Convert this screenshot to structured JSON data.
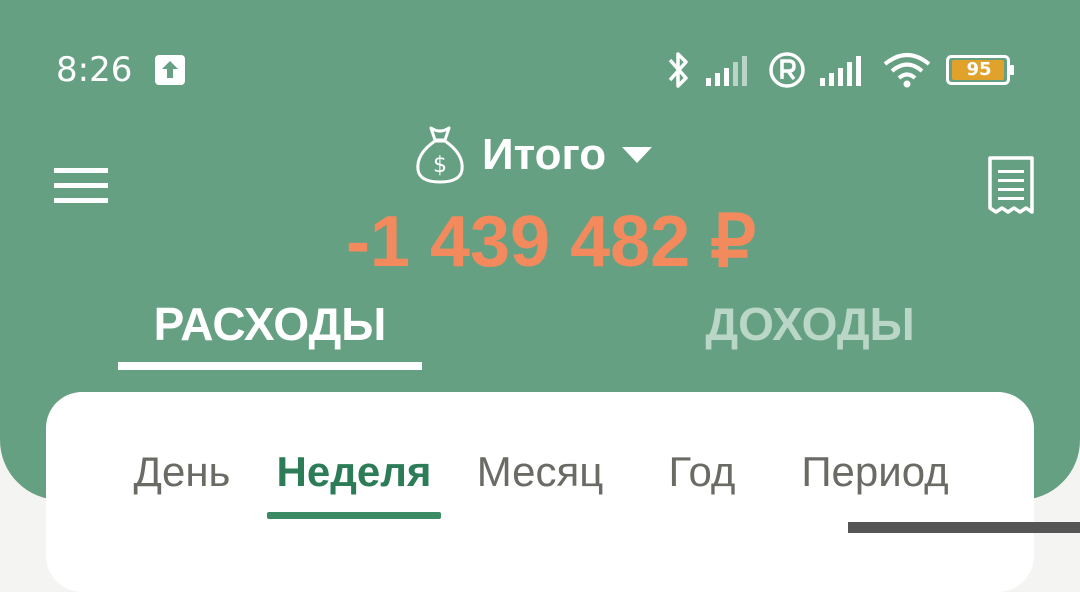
{
  "status_bar": {
    "time": "8:26",
    "battery_level": "95",
    "icons": [
      "upload-icon",
      "bluetooth-icon",
      "signal-icon",
      "roaming-icon",
      "signal-icon",
      "wifi-icon",
      "battery-icon"
    ]
  },
  "header": {
    "account_icon": "money-bag-icon",
    "account_title": "Итого",
    "total_amount": "-1 439 482 ₽"
  },
  "type_tabs": {
    "expenses": "РАСХОДЫ",
    "income": "ДОХОДЫ",
    "selected": "expenses"
  },
  "period_tabs": {
    "day": "День",
    "week": "Неделя",
    "month": "Месяц",
    "year": "Год",
    "period": "Период",
    "selected": "week"
  },
  "colors": {
    "header_background": "#66a083",
    "amount_negative": "#f28a5e",
    "active_period": "#2c7c58",
    "battery_fill": "#e0a22a"
  }
}
